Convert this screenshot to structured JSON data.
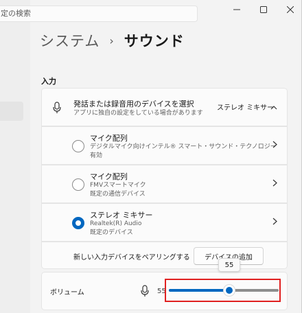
{
  "search": {
    "text": "定の検索"
  },
  "window_buttons": [
    "minimize-icon",
    "maximize-icon",
    "close-icon"
  ],
  "breadcrumb": {
    "parent": "システム",
    "separator": "›",
    "current": "サウンド"
  },
  "section_input": "入力",
  "input_header": {
    "title": "発話または録音用のデバイスを選択",
    "subtitle": "アプリに独自の設定をしている場合があります",
    "selected": "ステレオ ミキサー",
    "icon": "microphone-icon"
  },
  "devices": [
    {
      "name": "マイク配列",
      "line1": "デジタルマイク向けインテル® スマート・サウンド・テクノロジー",
      "line2": "有効",
      "selected": false
    },
    {
      "name": "マイク配列",
      "line1": "FMVスマートマイク",
      "line2": "既定の通信デバイス",
      "selected": false
    },
    {
      "name": "ステレオ ミキサー",
      "line1": "Realtek(R) Audio",
      "line2": "既定のデバイス",
      "selected": true
    }
  ],
  "pair": {
    "label": "新しい入力デバイスをペアリングする",
    "button": "デバイスの追加"
  },
  "volume": {
    "label": "ボリューム",
    "value": 55,
    "value_text": "55",
    "tooltip": "55"
  },
  "colors": {
    "accent": "#0067c0",
    "highlight_box": "#e02020"
  }
}
